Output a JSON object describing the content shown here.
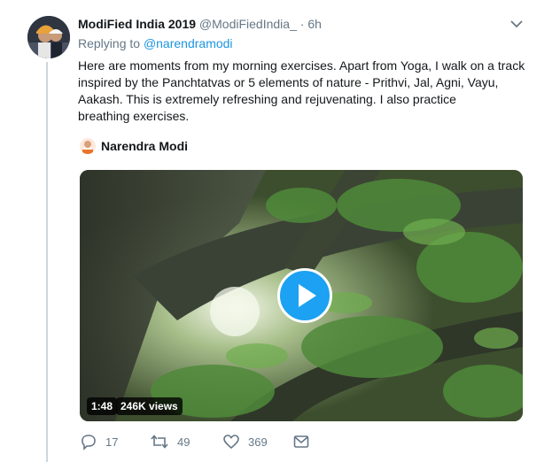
{
  "tweet": {
    "display_name": "ModiFied India 2019",
    "handle": "@ModiFiedIndia_",
    "separator": "·",
    "time": "6h",
    "replying_to_label": "Replying to",
    "replying_to_handle": "@narendramodi",
    "text_lines": [
      "Here are moments from my morning exercises. Apart from Yoga, I walk on a track",
      "inspired by the Panchtatvas or 5 elements of nature - Prithvi, Jal, Agni, Vayu,",
      "Aakash. This is extremely refreshing and rejuvenating. I also practice",
      "breathing exercises."
    ],
    "video_author": "Narendra Modi",
    "video": {
      "duration": "1:48",
      "views": "246K views"
    },
    "actions": {
      "replies": "17",
      "retweets": "49",
      "likes": "369"
    }
  },
  "icons": {
    "caret": "chevron-down-icon",
    "reply": "reply-icon",
    "retweet": "retweet-icon",
    "like": "heart-icon",
    "dm": "envelope-icon",
    "play": "play-icon"
  },
  "colors": {
    "link": "#1b95e0",
    "play_button": "#1da1f2",
    "muted_text": "#657786",
    "thread_line": "#ccd6dd"
  }
}
